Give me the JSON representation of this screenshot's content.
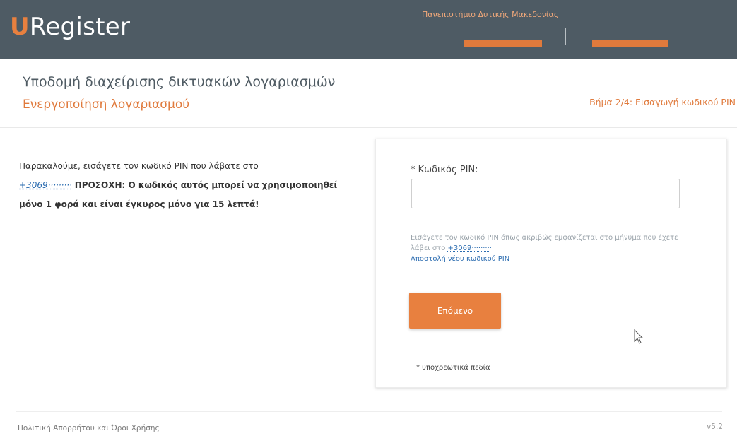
{
  "header": {
    "logo_u": "U",
    "logo_rest": "Register",
    "institution": "Πανεπιστήμιο Δυτικής Μακεδονίας"
  },
  "title_area": {
    "main_title": "Υποδομή διαχείρισης δικτυακών λογαριασμών",
    "sub_title": "Ενεργοποίηση λογαριασμού",
    "step": "Βήμα 2/4: Εισαγωγή κωδικού PIN"
  },
  "instructions": {
    "intro": "Παρακαλούμε, εισάγετε τον κωδικό PIN που λάβατε στο",
    "phone": "+3069·········",
    "warning": "ΠΡΟΣΟΧΗ: Ο κωδικός αυτός μπορεί να χρησιμοποιηθεί μόνο 1 φορά και είναι έγκυρος μόνο για 15 λεπτά!"
  },
  "form": {
    "pin_label": "* Κωδικός PIN:",
    "pin_value": "",
    "help_text": "Εισάγετε τον κωδικό PIN όπως ακριβώς εμφανίζεται στο μήνυμα που έχετε λάβει στο",
    "help_phone": "+3069·········",
    "resend_link": "Αποστολή νέου κωδικού PIN",
    "next_button": "Επόμενο",
    "required_note": "* υποχρεωτικά πεδία"
  },
  "footer": {
    "policy": "Πολιτική Απορρήτου και Όροι Χρήσης",
    "version": "v5.2"
  },
  "colors": {
    "header_bg": "#4e5b64",
    "accent": "#e8803f",
    "link": "#2b6cb0"
  },
  "icons": {
    "cursor": "mouse-pointer-icon"
  }
}
